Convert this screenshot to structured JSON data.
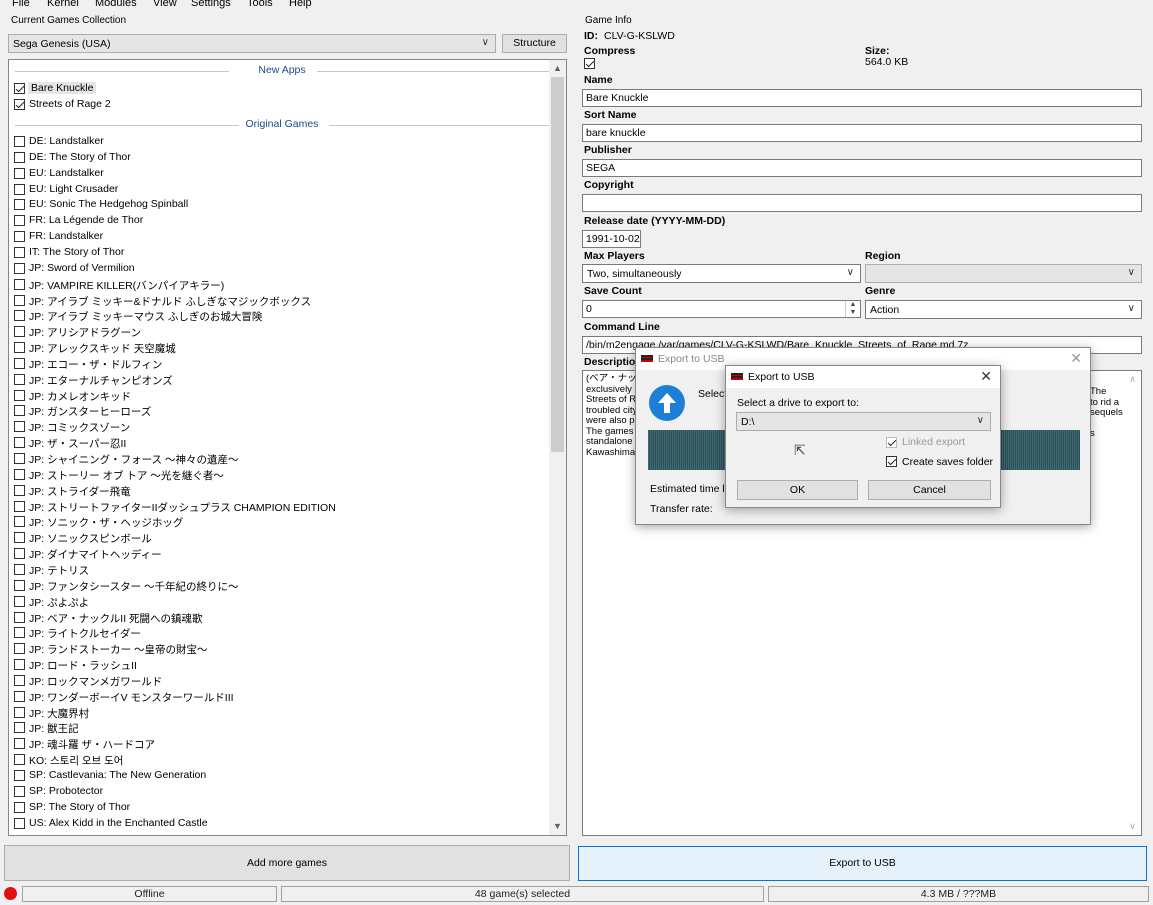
{
  "menu": [
    "File",
    "Kernel",
    "Modules",
    "View",
    "Settings",
    "Tools",
    "Help"
  ],
  "left": {
    "group_label": "Current Games Collection",
    "collection": "Sega Genesis (USA)",
    "structure_btn": "Structure",
    "sections": {
      "new_apps": "New Apps",
      "original": "Original Games"
    },
    "new_apps": [
      {
        "label": "Bare Knuckle",
        "checked": true,
        "selected": true
      },
      {
        "label": "Streets of Rage 2",
        "checked": true,
        "selected": false
      }
    ],
    "original_games": [
      "DE: Landstalker",
      "DE: The Story of Thor",
      "EU: Landstalker",
      "EU: Light Crusader",
      "EU: Sonic The Hedgehog Spinball",
      "FR: La Légende de Thor",
      "FR: Landstalker",
      "IT: The Story of Thor",
      "JP: Sword of Vermilion",
      "JP: VAMPIRE KILLER(バンパイアキラー)",
      "JP: アイラブ ミッキー&ドナルド ふしぎなマジックボックス",
      "JP: アイラブ ミッキーマウス ふしぎのお城大冒険",
      "JP: アリシアドラグーン",
      "JP: アレックスキッド 天空魔城",
      "JP: エコー・ザ・ドルフィン",
      "JP: エターナルチャンピオンズ",
      "JP: カメレオンキッド",
      "JP: ガンスターヒーローズ",
      "JP: コミックスゾーン",
      "JP: ザ・スーパー忍II",
      "JP: シャイニング・フォース 〜神々の遺産〜",
      "JP: ストーリー オブ トア 〜光を継ぐ者〜",
      "JP: ストライダー飛竜",
      "JP: ストリートファイターIIダッシュプラス CHAMPION EDITION",
      "JP: ソニック・ザ・ヘッジホッグ",
      "JP: ソニックスピンボール",
      "JP: ダイナマイトヘッディー",
      "JP: テトリス",
      "JP: ファンタシースター 〜千年紀の終りに〜",
      "JP: ぷよぷよ",
      "JP: ベア・ナックルII 死闘への鎮魂歌",
      "JP: ライトクルセイダー",
      "JP: ランドストーカー 〜皇帝の財宝〜",
      "JP: ロード・ラッシュII",
      "JP: ロックマンメガワールド",
      "JP: ワンダーボーイV モンスターワールドIII",
      "JP: 大魔界村",
      "JP: 獣王記",
      "JP: 魂斗羅 ザ・ハードコア",
      "KO: 스토리 오브 도어",
      "SP: Castlevania: The New Generation",
      "SP: Probotector",
      "SP: The Story of Thor",
      "US: Alex Kidd in the Enchanted Castle"
    ],
    "add_btn": "Add more games"
  },
  "info": {
    "group_label": "Game Info",
    "id_label": "ID:",
    "id_value": "CLV-G-KSLWD",
    "compress_label": "Compress",
    "size_label": "Size:",
    "size_value": "564.0 KB",
    "name_label": "Name",
    "name_value": "Bare Knuckle",
    "sort_label": "Sort Name",
    "sort_value": "bare knuckle",
    "publisher_label": "Publisher",
    "publisher_value": "SEGA",
    "copyright_label": "Copyright",
    "copyright_value": "",
    "release_label": "Release date (YYYY-MM-DD)",
    "release_value": "1991-10-02",
    "players_label": "Max Players",
    "players_value": "Two, simultaneously",
    "region_label": "Region",
    "region_value": "",
    "save_label": "Save Count",
    "save_value": "0",
    "genre_label": "Genre",
    "genre_value": "Action",
    "cmd_label": "Command Line",
    "cmd_value": "/bin/m2engage /var/games/CLV-G-KSLWD/Bare_Knuckle_Streets_of_Rage.md.7z",
    "desc_label": "Description",
    "desc_lines_left": [
      "(ベア・ナック",
      "exclusively f",
      "Streets of R",
      "troubled city",
      "were also pi",
      "The games",
      "standalone",
      "Kawashima"
    ],
    "desc_lines_right": [
      "The",
      "to rid a",
      "sequels",
      "",
      "s"
    ],
    "export_btn": "Export to USB"
  },
  "status": {
    "offline": "Offline",
    "selected": "48 game(s) selected",
    "size": "4.3 MB / ???MB"
  },
  "progress_dialog": {
    "title": "Export to USB",
    "select_text": "Select",
    "eta_label": "Estimated time left",
    "rate_label": "Transfer rate:"
  },
  "drive_dialog": {
    "title": "Export to USB",
    "prompt": "Select a drive to export to:",
    "drive": "D:\\",
    "linked_export": "Linked export",
    "create_saves": "Create saves folder",
    "ok": "OK",
    "cancel": "Cancel"
  }
}
